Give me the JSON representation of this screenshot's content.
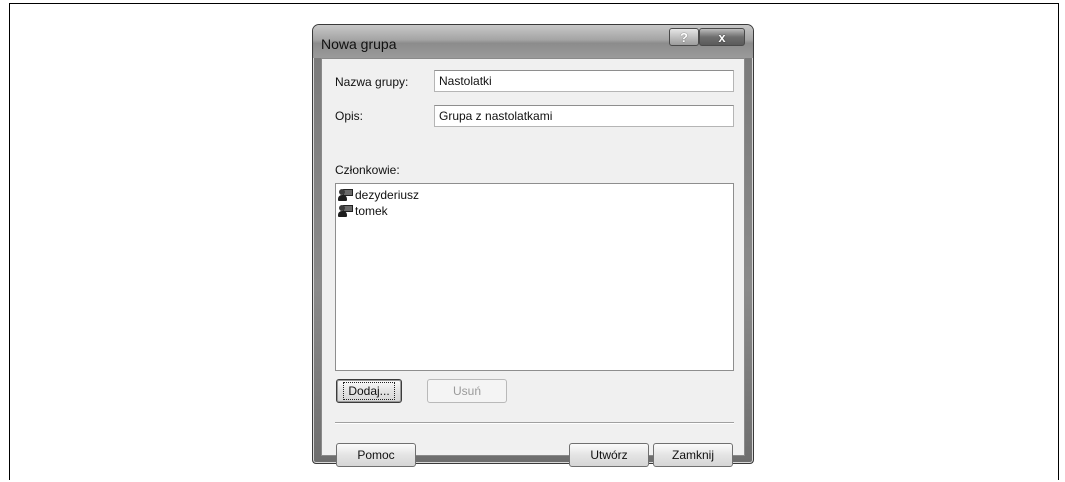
{
  "window": {
    "title": "Nowa grupa",
    "help_glyph": "?",
    "close_glyph": "x"
  },
  "form": {
    "name_label": "Nazwa grupy:",
    "name_value": "Nastolatki",
    "desc_label": "Opis:",
    "desc_value": "Grupa z nastolatkami",
    "members_label": "Członkowie:"
  },
  "members": [
    {
      "name": "dezyderiusz",
      "icon": "user-icon"
    },
    {
      "name": "tomek",
      "icon": "user-icon"
    }
  ],
  "buttons": {
    "add": "Dodaj...",
    "remove": "Usuń",
    "help": "Pomoc",
    "create": "Utwórz",
    "close": "Zamknij"
  }
}
